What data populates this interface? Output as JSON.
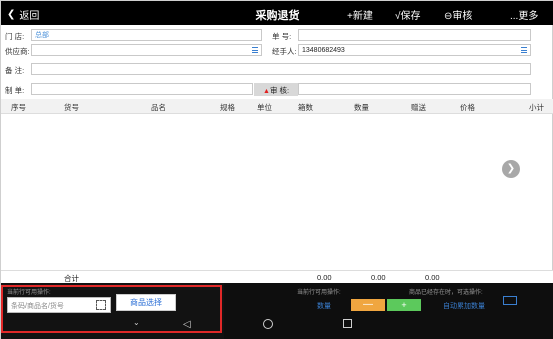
{
  "header": {
    "back_label": "返回",
    "title": "采购退货",
    "actions": [
      "+新建",
      "√保存",
      "⊖审核",
      "...更多"
    ]
  },
  "form": {
    "store_label": "门  店:",
    "store_value": "总部",
    "doc_no_label": "单  号:",
    "doc_no_value": "",
    "supplier_label": "供应商:",
    "supplier_value": "",
    "handler_label": "经手人:",
    "handler_value": "13480682493",
    "remark_label": "备  注:",
    "remark_value": "",
    "maker_label": "制  单:",
    "maker_value": "",
    "auditor_label": "审  核:",
    "auditor_value": ""
  },
  "table": {
    "columns": [
      "序号",
      "货号",
      "品名",
      "规格",
      "单位",
      "箱数",
      "数量",
      "赠送",
      "价格",
      "小计"
    ]
  },
  "totals": {
    "label": "合计",
    "boxes": "0.00",
    "quantity": "0.00",
    "gift": "0.00"
  },
  "bottom": {
    "current_row_hint_left": "当前行可用操作:",
    "scan_placeholder": "条码/商品名/货号",
    "goods_select_label": "商品选择",
    "current_row_hint_right": "当前行可用操作:",
    "exists_hint": "商品已经存在时，可选操作:",
    "qty_label": "数量",
    "minus_label": "—",
    "plus_label": "+",
    "auto_add_label": "自动累加数量"
  },
  "icons": {
    "back": "chevron-left-icon",
    "list": "list-icon",
    "next": "chevron-right-icon",
    "scan": "scan-icon",
    "keyboard": "keyboard-icon"
  },
  "colors": {
    "header_bg": "#000000",
    "link_blue": "#2b6fd6",
    "minus_orange": "#f0a640",
    "plus_green": "#5cc95c",
    "highlight_red": "#e02828"
  }
}
